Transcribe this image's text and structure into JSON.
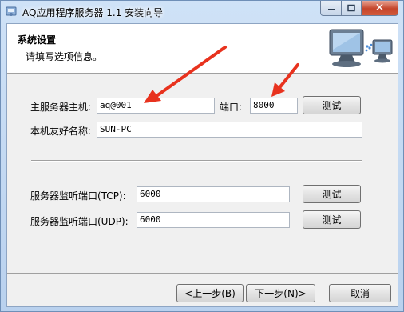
{
  "window": {
    "title": "AQ应用程序服务器 1.1 安装向导",
    "minimize_icon": "minimize-icon",
    "maximize_icon": "maximize-icon",
    "close_icon": "close-icon",
    "close_glyph": "✕"
  },
  "header": {
    "title": "系统设置",
    "subtitle": "请填写选项信息。",
    "image_icon": "computer-monitors-icon"
  },
  "form": {
    "server_host_label": "主服务器主机:",
    "server_host_value": "aq@001",
    "port_label": "端口:",
    "port_value": "8000",
    "test_label": "测试",
    "friendly_name_label": "本机友好名称:",
    "friendly_name_value": "SUN-PC",
    "tcp_label": "服务器监听端口(TCP):",
    "tcp_value": "6000",
    "udp_label": "服务器监听端口(UDP):",
    "udp_value": "6000"
  },
  "footer": {
    "back_label": "<上一步(B)",
    "next_label": "下一步(N)>",
    "cancel_label": "取消"
  },
  "colors": {
    "annotation_arrow": "#e8321e",
    "close_button": "#c4442a"
  }
}
